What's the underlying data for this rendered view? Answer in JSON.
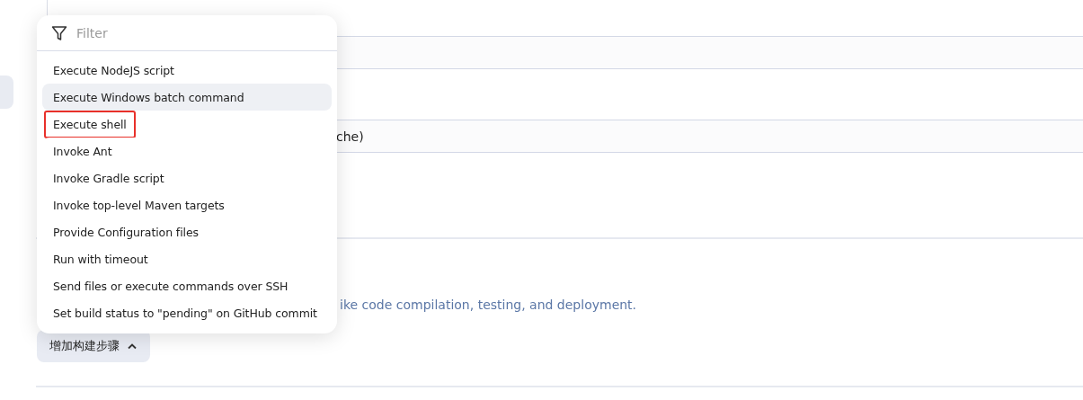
{
  "background": {
    "field_text": "che)",
    "description": "ike code compilation, testing, and deployment.",
    "add_step_button": {
      "label": "增加构建步骤",
      "expanded": true
    }
  },
  "menu": {
    "filter": {
      "placeholder": "Filter"
    },
    "items": [
      {
        "label": "Execute NodeJS script",
        "hovered": false,
        "annotated": false
      },
      {
        "label": "Execute Windows batch command",
        "hovered": true,
        "annotated": false
      },
      {
        "label": "Execute shell",
        "hovered": false,
        "annotated": true
      },
      {
        "label": "Invoke Ant",
        "hovered": false,
        "annotated": false
      },
      {
        "label": "Invoke Gradle script",
        "hovered": false,
        "annotated": false
      },
      {
        "label": "Invoke top-level Maven targets",
        "hovered": false,
        "annotated": false
      },
      {
        "label": "Provide Configuration files",
        "hovered": false,
        "annotated": false
      },
      {
        "label": "Run with timeout",
        "hovered": false,
        "annotated": false
      },
      {
        "label": "Send files or execute commands over SSH",
        "hovered": false,
        "annotated": false
      },
      {
        "label": "Set build status to \"pending\" on GitHub commit",
        "hovered": false,
        "annotated": false
      }
    ]
  }
}
